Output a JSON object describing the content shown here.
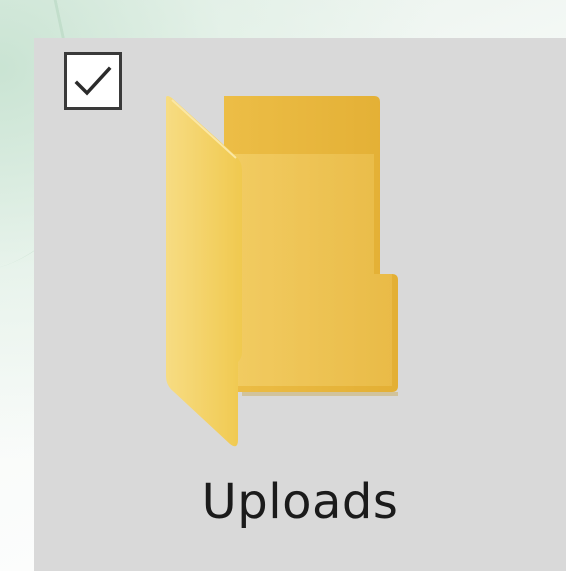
{
  "folder": {
    "name": "Uploads",
    "selected": true,
    "icon": "folder-icon",
    "checkbox_icon": "checkmark-icon"
  },
  "colors": {
    "tile_background": "#d9d9d9",
    "folder_front": "#f2cf66",
    "folder_back": "#e9b93b",
    "checkbox_border": "#3a3a3a"
  }
}
